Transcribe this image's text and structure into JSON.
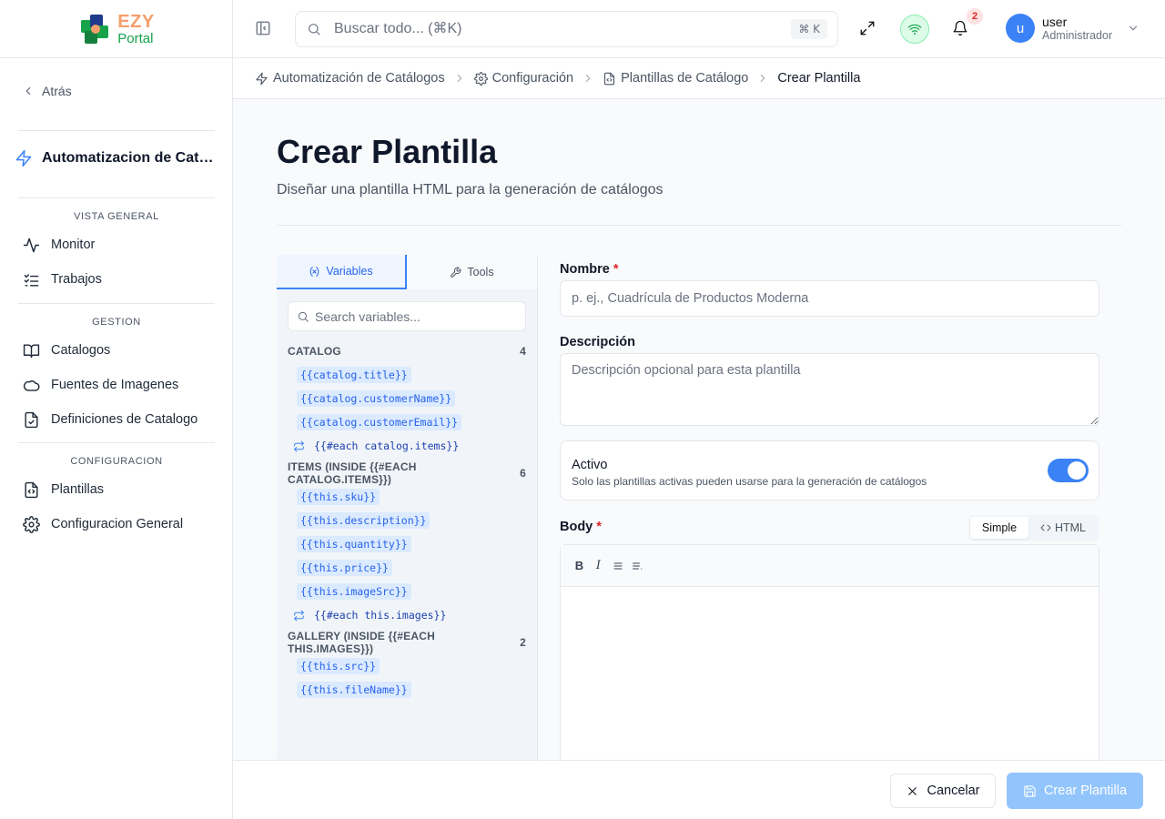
{
  "logo": {
    "brand": "EZY",
    "product": "Portal"
  },
  "sidebar": {
    "back_label": "Atrás",
    "module_title": "Automatizacion de Catalogos",
    "sections": [
      {
        "title": "VISTA GENERAL",
        "items": [
          {
            "label": "Monitor",
            "icon": "activity-icon"
          },
          {
            "label": "Trabajos",
            "icon": "list-checks-icon"
          }
        ]
      },
      {
        "title": "GESTION",
        "items": [
          {
            "label": "Catalogos",
            "icon": "book-open-icon"
          },
          {
            "label": "Fuentes de Imagenes",
            "icon": "cloud-icon"
          },
          {
            "label": "Definiciones de Catalogo",
            "icon": "file-check-icon"
          }
        ]
      },
      {
        "title": "CONFIGURACION",
        "items": [
          {
            "label": "Plantillas",
            "icon": "file-code-icon"
          },
          {
            "label": "Configuracion General",
            "icon": "gear-icon"
          }
        ]
      }
    ]
  },
  "topbar": {
    "search_placeholder": "Buscar todo... (⌘K)",
    "search_shortcut": "⌘ K",
    "notifications_count": "2",
    "user": {
      "initial": "u",
      "name": "user",
      "role": "Administrador"
    }
  },
  "breadcrumb": [
    {
      "label": "Automatización de Catálogos",
      "icon": "zap-icon"
    },
    {
      "label": "Configuración",
      "icon": "gear-icon"
    },
    {
      "label": "Plantillas de Catálogo",
      "icon": "file-code-icon"
    },
    {
      "label": "Crear Plantilla",
      "icon": ""
    }
  ],
  "page": {
    "title": "Crear Plantilla",
    "subtitle": "Diseñar una plantilla HTML para la generación de catálogos"
  },
  "variables_panel": {
    "tabs": [
      {
        "label": "Variables",
        "active": true
      },
      {
        "label": "Tools",
        "active": false
      }
    ],
    "search_placeholder": "Search variables...",
    "groups": [
      {
        "title": "CATALOG",
        "count": "4",
        "vars": [
          "{{catalog.title}}",
          "{{catalog.customerName}}",
          "{{catalog.customerEmail}}"
        ],
        "loop": "{{#each catalog.items}}"
      },
      {
        "title": "ITEMS (INSIDE {{#EACH CATALOG.ITEMS}})",
        "count": "6",
        "vars": [
          "{{this.sku}}",
          "{{this.description}}",
          "{{this.quantity}}",
          "{{this.price}}",
          "{{this.imageSrc}}"
        ],
        "loop": "{{#each this.images}}"
      },
      {
        "title": "GALLERY (INSIDE {{#EACH THIS.IMAGES}})",
        "count": "2",
        "vars": [
          "{{this.src}}",
          "{{this.fileName}}"
        ],
        "loop": ""
      }
    ]
  },
  "form": {
    "nombre_label": "Nombre",
    "nombre_placeholder": "p. ej., Cuadrícula de Productos Moderna",
    "descripcion_label": "Descripción",
    "descripcion_placeholder": "Descripción opcional para esta plantilla",
    "activo_label": "Activo",
    "activo_hint": "Solo las plantillas activas pueden usarse para la generación de catálogos",
    "activo_on": true,
    "body_label": "Body",
    "mode_simple": "Simple",
    "mode_html": "HTML",
    "toolbar": {
      "bold": "B",
      "italic": "I"
    }
  },
  "footer": {
    "cancel_label": "Cancelar",
    "create_label": "Crear Plantilla"
  },
  "colors": {
    "primary": "#3b82f6",
    "primary_disabled": "#93c5fd",
    "required": "#dc2626",
    "logo_orange": "#f59e6b",
    "logo_green": "#16a34a"
  }
}
